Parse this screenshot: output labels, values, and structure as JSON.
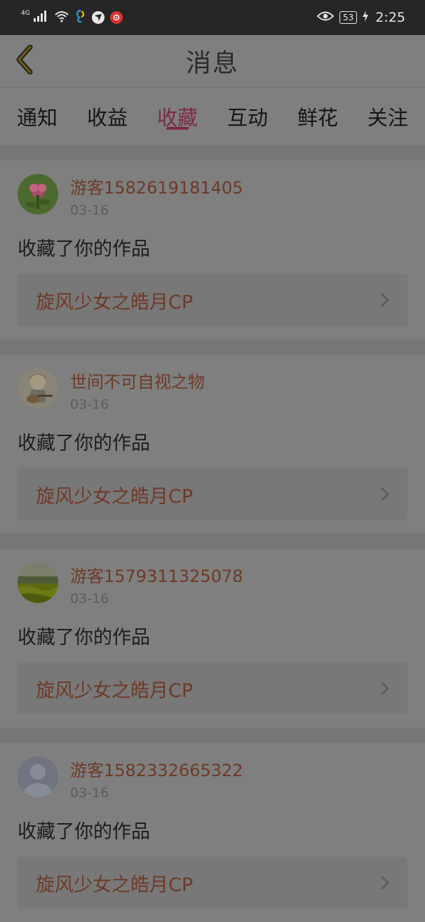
{
  "status_bar": {
    "network": "4G",
    "battery": "53",
    "time": "2:25"
  },
  "header": {
    "title": "消息"
  },
  "tabs": [
    {
      "label": "通知"
    },
    {
      "label": "收益"
    },
    {
      "label": "收藏",
      "active": true
    },
    {
      "label": "互动"
    },
    {
      "label": "鲜花"
    },
    {
      "label": "关注"
    }
  ],
  "messages": [
    {
      "user": "游客1582619181405",
      "date": "03-16",
      "action": "收藏了你的作品",
      "work": "旋风少女之皓月CP",
      "avatar": "flower-avatar"
    },
    {
      "user": "世间不可自视之物",
      "date": "03-16",
      "action": "收藏了你的作品",
      "work": "旋风少女之皓月CP",
      "avatar": "anime-guitar-avatar"
    },
    {
      "user": "游客1579311325078",
      "date": "03-16",
      "action": "收藏了你的作品",
      "work": "旋风少女之皓月CP",
      "avatar": "field-avatar"
    },
    {
      "user": "游客1582332665322",
      "date": "03-16",
      "action": "收藏了你的作品",
      "work": "旋风少女之皓月CP",
      "avatar": "default-avatar"
    }
  ],
  "colors": {
    "accent": "#7c2a48",
    "username": "#6f3a26",
    "overlay_background": "#808080"
  }
}
